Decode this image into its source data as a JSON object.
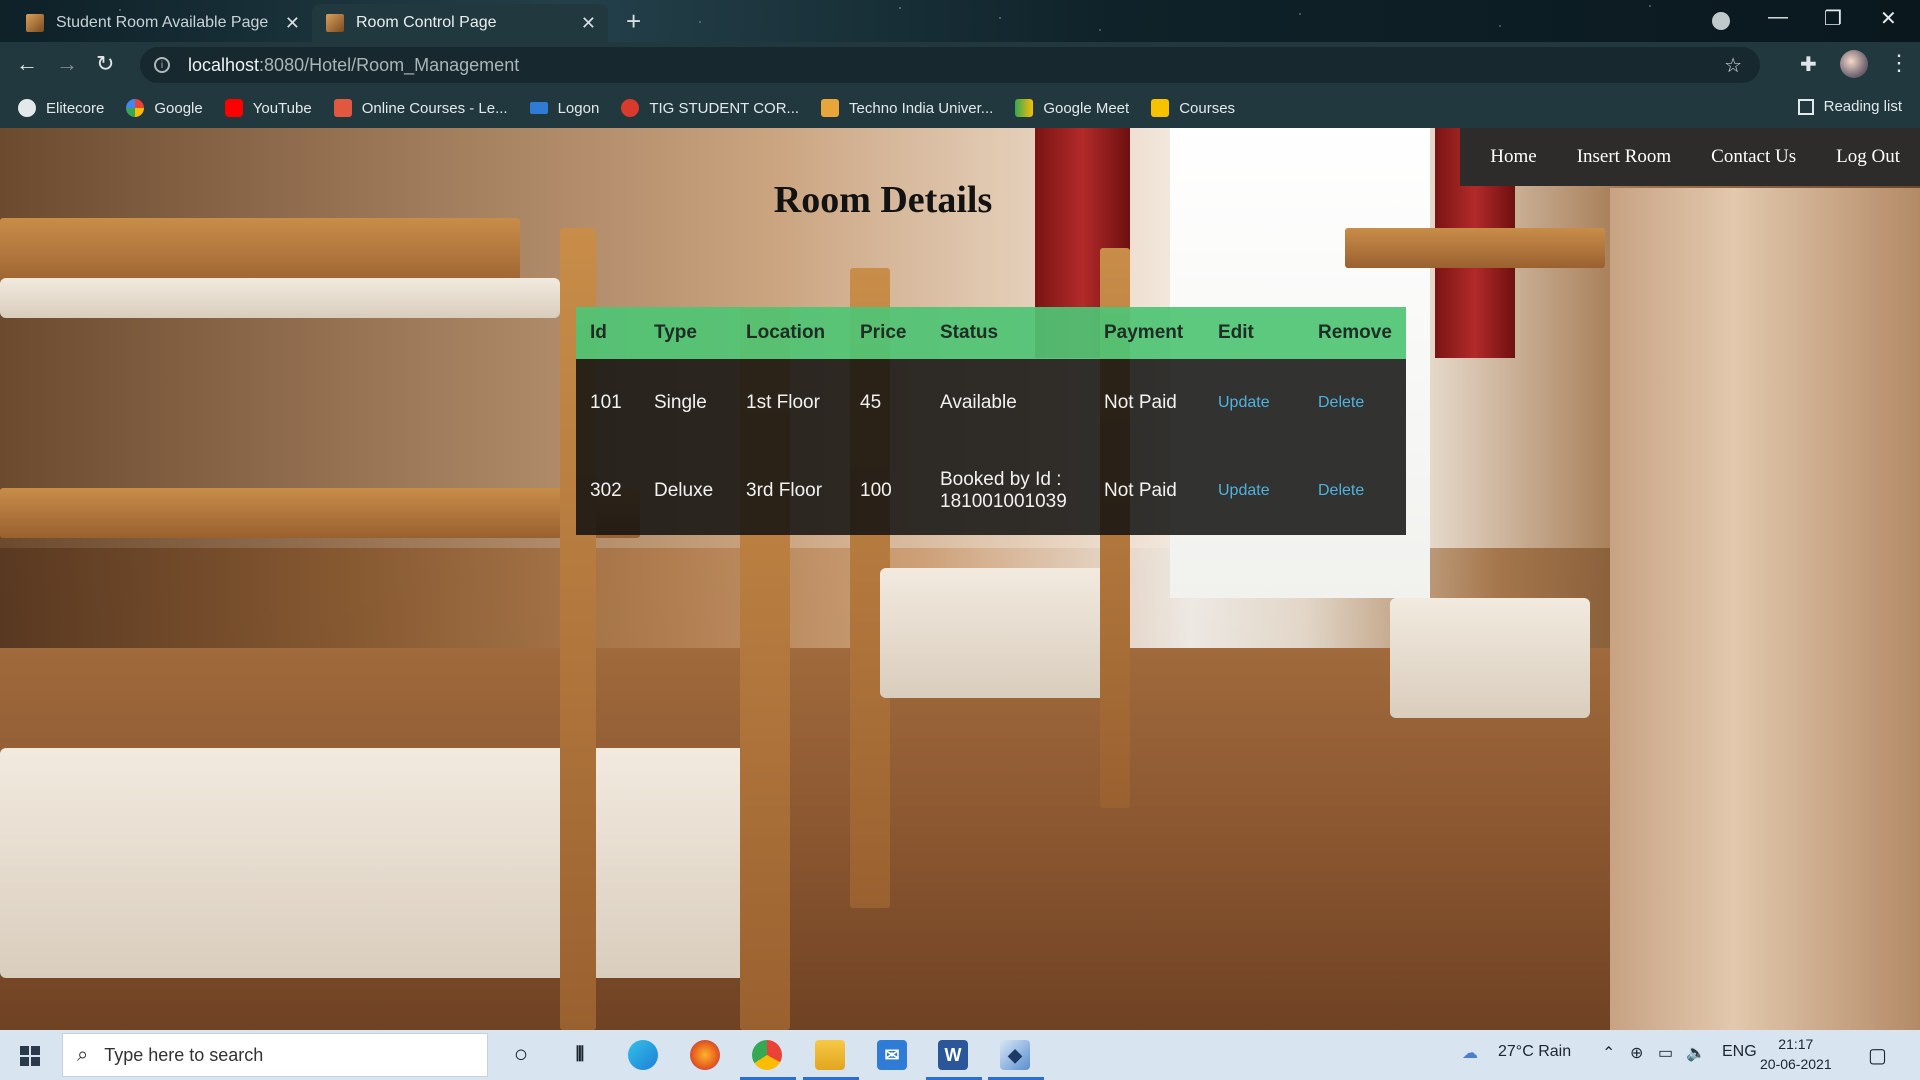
{
  "browser": {
    "tabs": [
      {
        "title": "Student Room Available Page",
        "active": false
      },
      {
        "title": "Room Control Page",
        "active": true
      }
    ],
    "url_host": "localhost",
    "url_path": ":8080/Hotel/Room_Management",
    "bookmarks": [
      {
        "label": "Elitecore",
        "icon": "globe-icon",
        "color": "#e3e9eb"
      },
      {
        "label": "Google",
        "icon": "google-icon",
        "color": "#ffffff"
      },
      {
        "label": "YouTube",
        "icon": "youtube-icon",
        "color": "#ff0000"
      },
      {
        "label": "Online Courses - Le...",
        "icon": "courses-icon",
        "color": "#e0583f"
      },
      {
        "label": "Logon",
        "icon": "sap-icon",
        "color": "#2f7bd6"
      },
      {
        "label": "TIG STUDENT COR...",
        "icon": "tig-icon",
        "color": "#d93a2b"
      },
      {
        "label": "Techno India Univer...",
        "icon": "techno-icon",
        "color": "#e8a63a"
      },
      {
        "label": "Google Meet",
        "icon": "meet-icon",
        "color": "#34a853"
      },
      {
        "label": "Courses",
        "icon": "classroom-icon",
        "color": "#f7c300"
      }
    ],
    "reading_list": "Reading list"
  },
  "site": {
    "nav": [
      "Home",
      "Insert Room",
      "Contact Us",
      "Log Out"
    ],
    "title": "Room Details",
    "table": {
      "headers": [
        "Id",
        "Type",
        "Location",
        "Price",
        "Status",
        "Payment",
        "Edit",
        "Remove"
      ],
      "rows": [
        {
          "id": "101",
          "type": "Single",
          "location": "1st Floor",
          "price": "45",
          "status": "Available",
          "status2": "",
          "payment": "Not Paid",
          "edit": "Update",
          "remove": "Delete"
        },
        {
          "id": "302",
          "type": "Deluxe",
          "location": "3rd Floor",
          "price": "100",
          "status": "Booked by Id :",
          "status2": "181001001039",
          "payment": "Not Paid",
          "edit": "Update",
          "remove": "Delete"
        }
      ]
    },
    "colors": {
      "header_row": "#4ec474",
      "link": "#4fb3e0",
      "nav_bg": "#2e2c2b"
    }
  },
  "taskbar": {
    "search_placeholder": "Type here to search",
    "weather": "27°C  Rain",
    "language": "ENG",
    "time": "21:17",
    "date": "20-06-2021"
  }
}
